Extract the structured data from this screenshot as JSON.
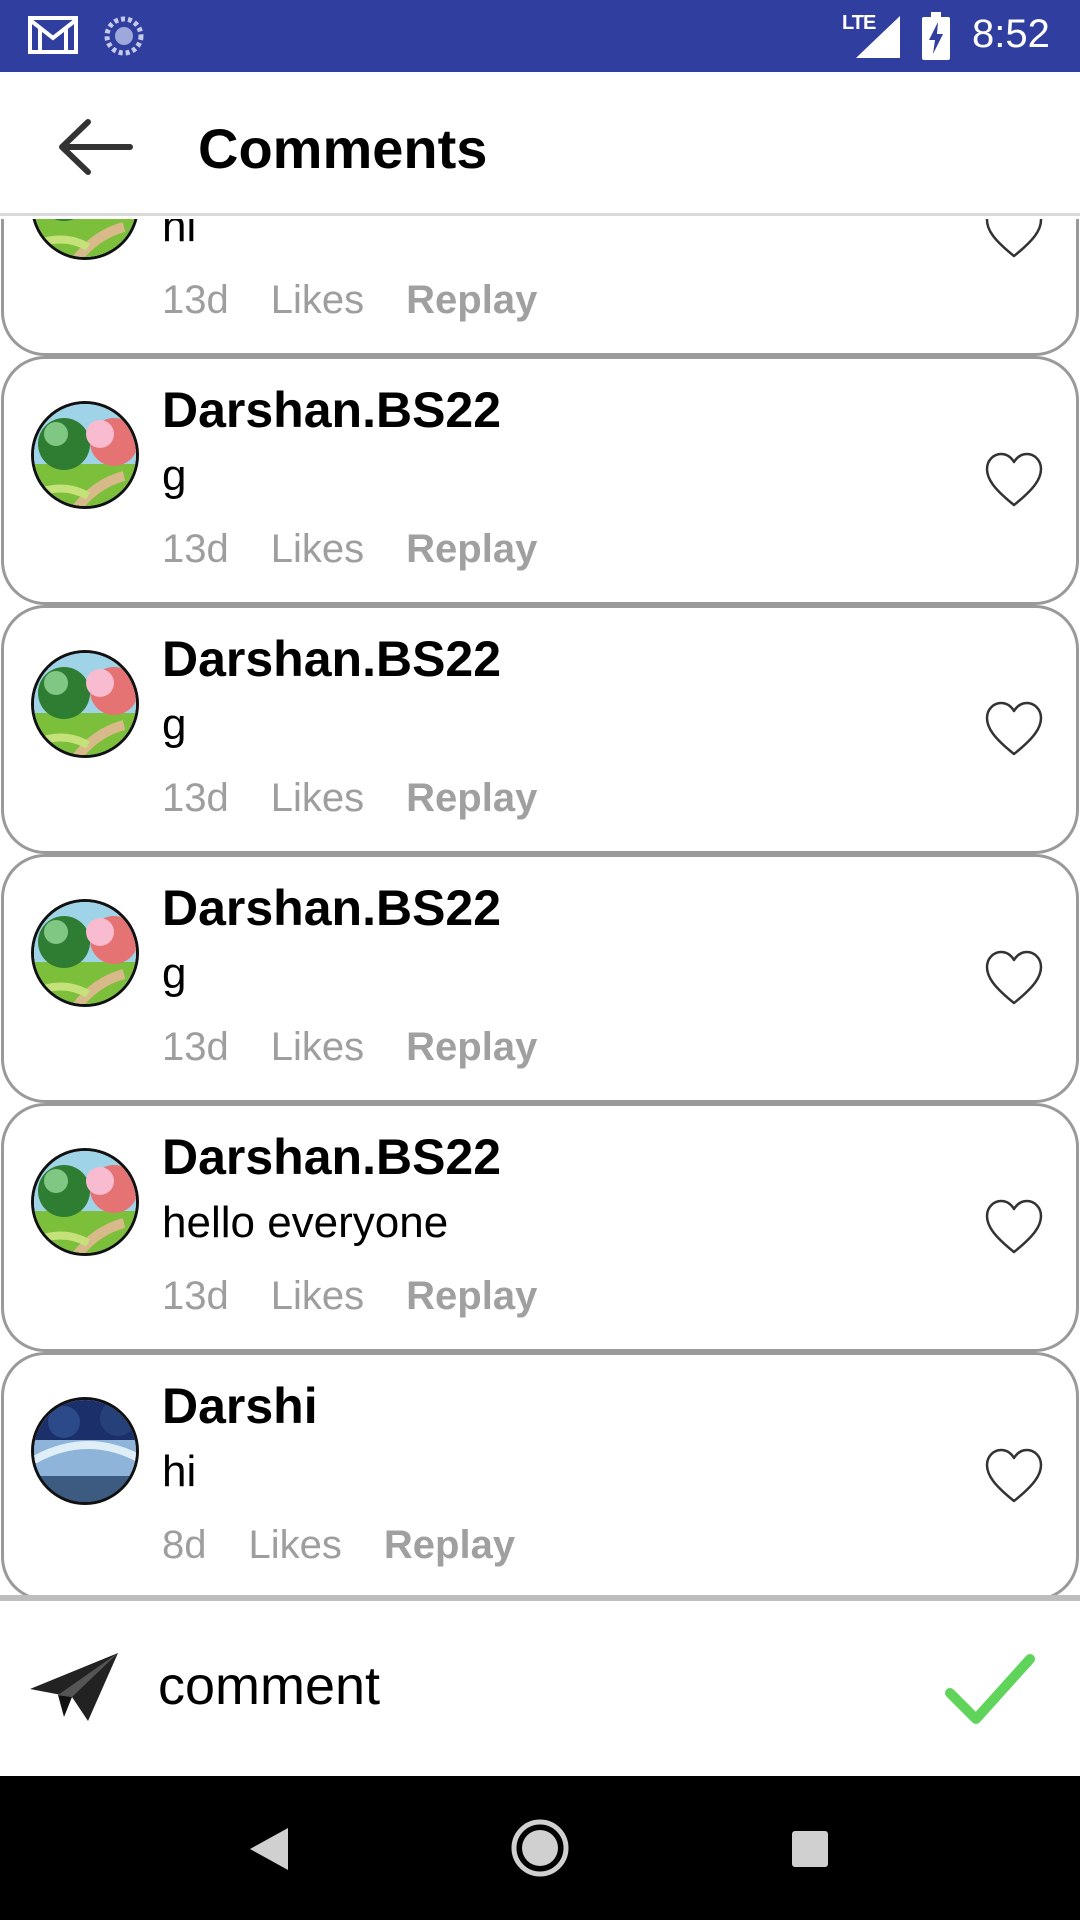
{
  "status_bar": {
    "network": "LTE",
    "time": "8:52",
    "icons": [
      "gmail-icon",
      "sync-icon",
      "signal-icon",
      "battery-charging-icon"
    ]
  },
  "app_bar": {
    "title": "Comments",
    "back_icon": "arrow-back-icon"
  },
  "comments": [
    {
      "username": "",
      "text": "hi",
      "age": "13d",
      "likes_label": "Likes",
      "reply_label": "Replay",
      "avatar": "landscape-park-avatar"
    },
    {
      "username": "Darshan.BS22",
      "text": "g",
      "age": "13d",
      "likes_label": "Likes",
      "reply_label": "Replay",
      "avatar": "landscape-park-avatar"
    },
    {
      "username": "Darshan.BS22",
      "text": "g",
      "age": "13d",
      "likes_label": "Likes",
      "reply_label": "Replay",
      "avatar": "landscape-park-avatar"
    },
    {
      "username": "Darshan.BS22",
      "text": "g",
      "age": "13d",
      "likes_label": "Likes",
      "reply_label": "Replay",
      "avatar": "landscape-park-avatar"
    },
    {
      "username": "Darshan.BS22",
      "text": "hello everyone",
      "age": "13d",
      "likes_label": "Likes",
      "reply_label": "Replay",
      "avatar": "landscape-park-avatar"
    },
    {
      "username": "Darshi",
      "text": "hi",
      "age": "8d",
      "likes_label": "Likes",
      "reply_label": "Replay",
      "avatar": "blue-landscape-avatar"
    }
  ],
  "input_bar": {
    "placeholder": "comment",
    "send_icon": "send-icon",
    "submit_icon": "check-icon",
    "submit_color": "#5fd35a"
  },
  "colors": {
    "status_bar": "#303f9f",
    "meta_text": "#9e9e9e",
    "card_border": "#9a9a9a"
  }
}
